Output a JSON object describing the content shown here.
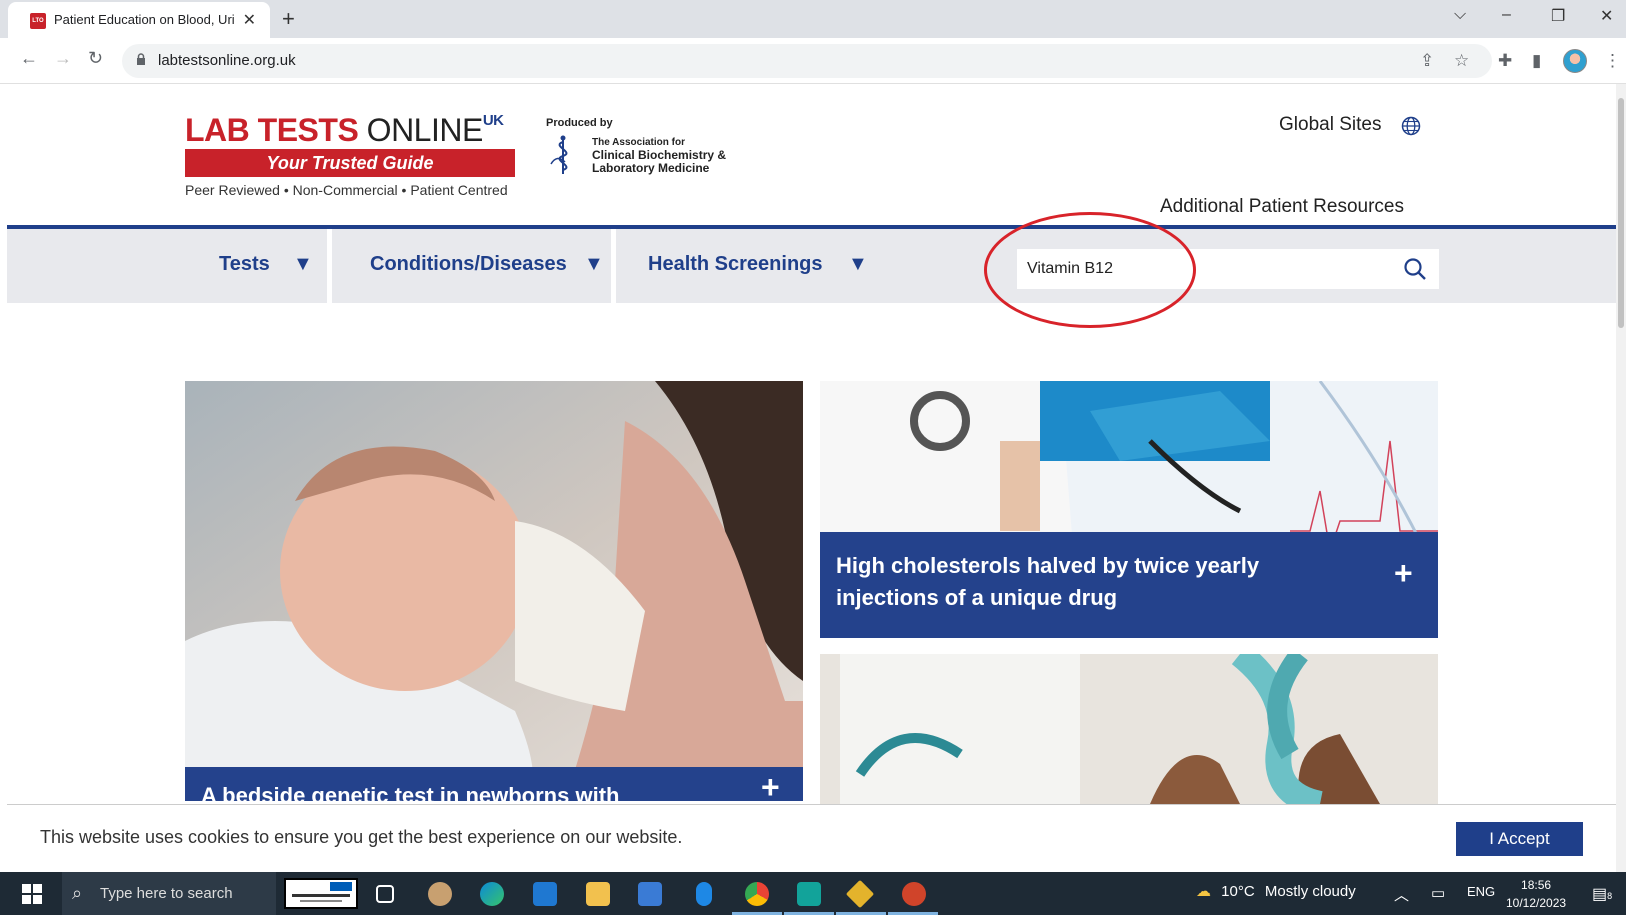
{
  "browser": {
    "tab_title": "Patient Education on Blood, Urine",
    "tab_favicon": "LTO",
    "url": "labtestsonline.org.uk"
  },
  "site": {
    "logo_lab": "LAB TESTS",
    "logo_online": " ONLINE",
    "logo_uk": "UK",
    "logo_tagline": "Your Trusted Guide",
    "logo_values": "Peer Reviewed • Non-Commercial • Patient Centred",
    "produced_by": "Produced by",
    "acb_line1": "The Association for",
    "acb_line2": "Clinical Biochemistry &",
    "acb_line3": "Laboratory Medicine",
    "global_sites": "Global Sites",
    "additional_resources": "Additional Patient Resources"
  },
  "nav": {
    "items": [
      {
        "label": "Tests",
        "arrow": "▼"
      },
      {
        "label": "Conditions/Diseases",
        "arrow": "▼"
      },
      {
        "label": "Health Screenings",
        "arrow": "▼"
      }
    ],
    "search_value": "Vitamin B12"
  },
  "cards": {
    "left_caption": "A bedside genetic test in newborns with",
    "right_top_caption_line1": "High cholesterols halved by twice yearly",
    "right_top_caption_line2": "injections of a unique drug",
    "plus": "+"
  },
  "cookie": {
    "text": "This website uses cookies to ensure you get the best experience on our website.",
    "accept_label": "I Accept"
  },
  "taskbar": {
    "search_placeholder": "Type here to search",
    "temperature": "10°C",
    "weather": "Mostly cloudy",
    "language": "ENG",
    "time": "18:56",
    "date": "10/12/2023",
    "notification_count": "8"
  },
  "colors": {
    "brand_red": "#c8222a",
    "brand_blue": "#1f3f8a",
    "caption_blue": "#24428c",
    "annotation_red": "#d8232a"
  }
}
